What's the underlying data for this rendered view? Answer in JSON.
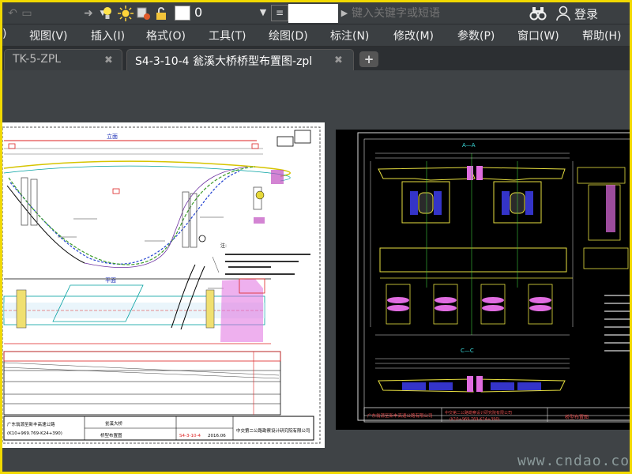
{
  "toolbar": {
    "layer_value": "0",
    "search_placeholder": "键入关键字或短语",
    "login_label": "登录"
  },
  "menubar": {
    "items": [
      ")",
      "视图(V)",
      "插入(I)",
      "格式(O)",
      "工具(T)",
      "绘图(D)",
      "标注(N)",
      "修改(M)",
      "参数(P)",
      "窗口(W)",
      "帮助(H)"
    ]
  },
  "tabs": {
    "items": [
      {
        "label": "TK-5-ZPL"
      },
      {
        "label": "S4-3-10-4 瓮溪大桥桥型布置图-zpl"
      }
    ],
    "add_label": "+"
  },
  "drawing": {
    "left_sheet": {
      "top_section_label": "立面",
      "plan_label": "平面",
      "notes_label": "注:",
      "title_block": {
        "design_company": "中交第二公路勘察设计研究院有限公司",
        "drawing_name": "桥型布置图",
        "bridge_name": "瓮溪大桥",
        "drawing_no": "S4-3-10-4",
        "date": "2016.06",
        "left_text": "广东翁源至新丰高速公路",
        "left_text2": "(K10+969.769-K24+390)"
      }
    },
    "right_sheet": {
      "section_aa": "A—A",
      "section_cc": "C—C",
      "title_block": {
        "left_company": "广东翁源至新丰高速公路有限公司",
        "mid_text": "中交第二公路勘察设计研究院有限公司",
        "mid_text2": "(K10+969.769-K24+390)",
        "drawing_name": "桥型布置图"
      }
    }
  },
  "watermark": "www.cndao.com"
}
